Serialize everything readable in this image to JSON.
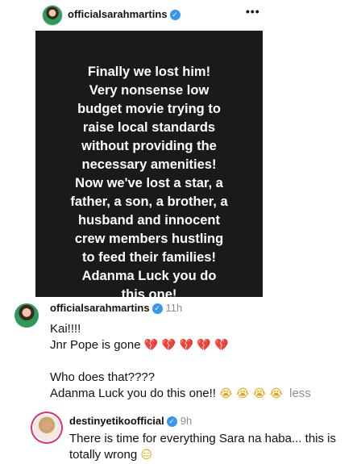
{
  "post": {
    "username": "officialsarahmartins",
    "verified_icon": "verified-badge-icon",
    "more_icon": "more-options-icon",
    "more_glyph": "•••",
    "image_text": "Finally we lost him! Very nonsense low budget movie trying to raise local standards without providing the necessary amenities! Now we've lost a star, a father, a son, a brother, a husband and innocent crew members hustling to feed their families! Adanma Luck you do this one!",
    "image_lines": [
      "Finally we lost him!",
      "Very nonsense low",
      "budget movie trying to",
      "raise local standards",
      "without providing the",
      "necessary amenities!",
      "Now we've lost a star, a",
      "father, a son, a brother, a",
      "husband and innocent",
      "crew members hustling",
      "to feed their families!",
      "Adanma Luck you do",
      "this one!"
    ]
  },
  "comments": [
    {
      "username": "officialsarahmartins",
      "time": "11h",
      "lines": {
        "l1": "Kai!!!!",
        "l2": "Jnr Pope is gone",
        "l2_emoji": "💔 💔 💔 💔 💔",
        "l3": "Who does that????",
        "l4": "Adanma Luck you do this one!!",
        "l4_emoji": "😭 😭 😭 😭",
        "less": "less"
      }
    },
    {
      "username": "destinyetikoofficial",
      "time": "9h",
      "text": "There is time for everything Sara na haba... this is totally wrong",
      "emoji": "😑"
    }
  ],
  "colors": {
    "verified": "#3797f0",
    "story_ring": "#e1306c",
    "muted": "#8e8e8e",
    "post_bg": "#1a1a1a"
  }
}
